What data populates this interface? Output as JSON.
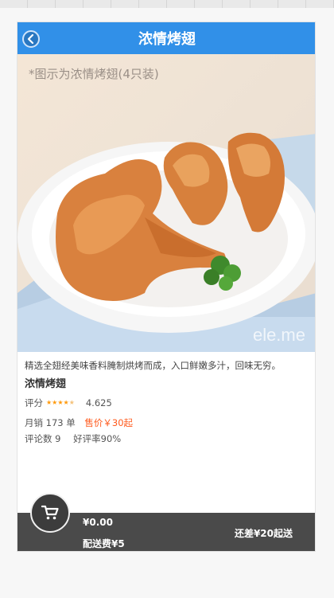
{
  "header": {
    "title": "浓情烤翅"
  },
  "hero": {
    "caption": "*图示为浓情烤翅(4只装)",
    "watermark": "ele.me"
  },
  "product": {
    "description": "精选全翅经美味香料腌制烘烤而成，入口鲜嫩多汁，回味无穷。",
    "name": "浓情烤翅",
    "rating_label": "评分",
    "rating_stars": 4.5,
    "rating_score": "4.625",
    "monthly_sales": "月销 173 单",
    "price_label": "售价￥30起",
    "review_count": "评论数 9",
    "good_rate": "好评率90%"
  },
  "cart": {
    "total": "¥0.00",
    "delivery_fee": "配送费¥5",
    "min_order_gap": "还差¥20起送"
  },
  "colors": {
    "header": "#3190e8",
    "price": "#ff5a1d",
    "stars": "#ff9a0d",
    "footer": "#4a4a4a"
  }
}
